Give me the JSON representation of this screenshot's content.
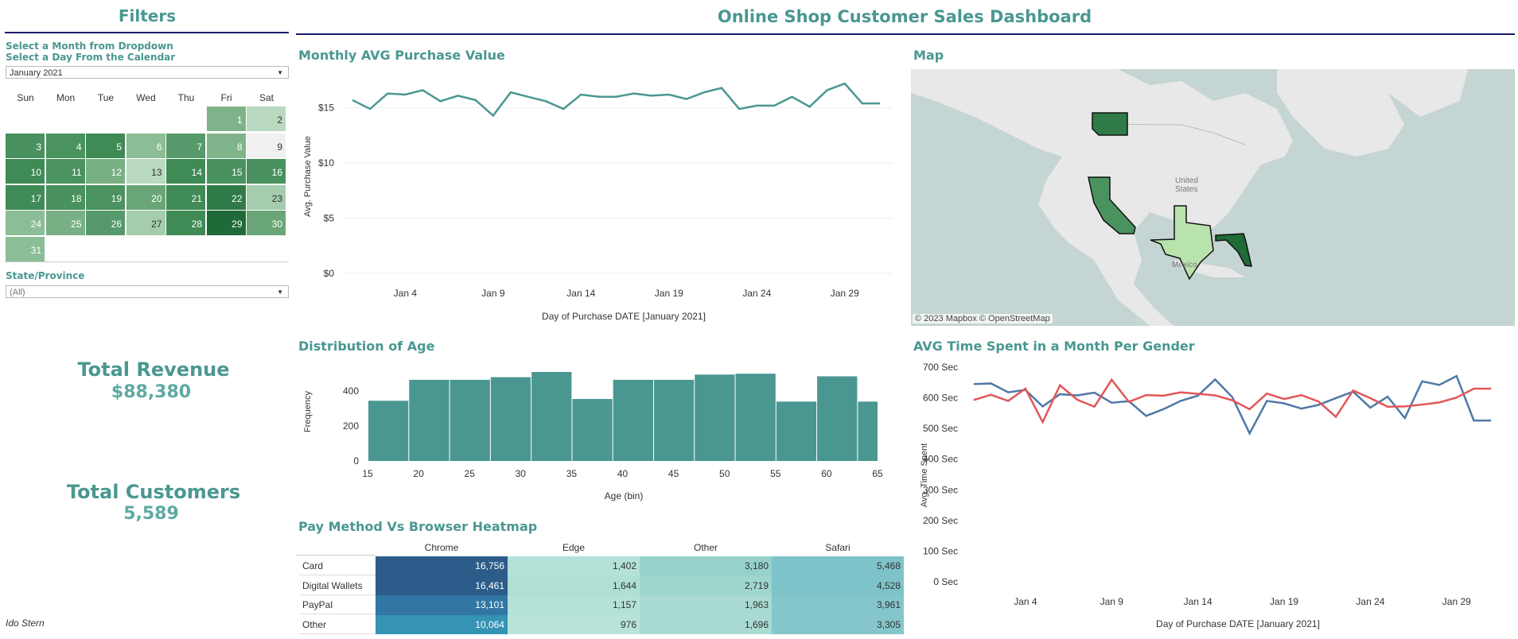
{
  "filters": {
    "title": "Filters",
    "month_instruction": "Select a Month from Dropdown",
    "day_instruction": "Select a Day From the Calendar",
    "month_value": "January 2021",
    "state_label": "State/Province",
    "state_value": "(All)"
  },
  "calendar": {
    "days": [
      "Sun",
      "Mon",
      "Tue",
      "Wed",
      "Thu",
      "Fri",
      "Sat"
    ],
    "start_weekday": 5,
    "num_days": 31,
    "cell_colors": [
      "#7fb48b",
      "#b9d9c1",
      "#49915e",
      "#4a935f",
      "#3f8a55",
      "#8bbd96",
      "#56996a",
      "#7fb48b",
      "#f0f0f0",
      "#3f8a55",
      "#4a935f",
      "#78b083",
      "#b9d9c1",
      "#3f8a55",
      "#49915e",
      "#49915e",
      "#3f8a55",
      "#49915e",
      "#4a935f",
      "#6aa577",
      "#3f8a55",
      "#2f7a46",
      "#a4ccad",
      "#8bbd96",
      "#78b083",
      "#56996a",
      "#a4ccad",
      "#3f8a55",
      "#1f6a37",
      "#6aa577",
      "#8bbd96"
    ]
  },
  "kpis": {
    "revenue_label": "Total Revenue",
    "revenue_value": "$88,380",
    "customers_label": "Total Customers",
    "customers_value": "5,589"
  },
  "author": "Ido Stern",
  "dashboard_title": "Online Shop Customer Sales Dashboard",
  "line_chart": {
    "title": "Monthly AVG Purchase Value",
    "chart_data": {
      "type": "line",
      "x": [
        1,
        2,
        3,
        4,
        5,
        6,
        7,
        8,
        9,
        10,
        11,
        12,
        13,
        14,
        15,
        16,
        17,
        18,
        19,
        20,
        21,
        22,
        23,
        24,
        25,
        26,
        27,
        28,
        29,
        30,
        31
      ],
      "values": [
        15.7,
        14.9,
        16.3,
        16.2,
        16.6,
        15.6,
        16.1,
        15.7,
        14.3,
        16.4,
        16.0,
        15.6,
        14.9,
        16.2,
        16.0,
        16.0,
        16.3,
        16.1,
        16.2,
        15.8,
        16.4,
        16.8,
        14.9,
        15.2,
        15.2,
        16.0,
        15.1,
        16.6,
        17.2,
        15.4,
        15.4
      ],
      "ylim": [
        0,
        18
      ],
      "yticks": [
        "$0",
        "$5",
        "$10",
        "$15"
      ],
      "ytick_values": [
        0,
        5,
        10,
        15
      ],
      "xticks": [
        "Jan 4",
        "Jan 9",
        "Jan 14",
        "Jan 19",
        "Jan 24",
        "Jan 29"
      ],
      "xtick_values": [
        4,
        9,
        14,
        19,
        24,
        29
      ],
      "xlabel": "Day of Purchase DATE [January 2021]",
      "ylabel": "Avg. Purchase Value",
      "color": "#4a9791"
    }
  },
  "map": {
    "title": "Map",
    "attribution": "© 2023 Mapbox  © OpenStreetMap",
    "labels": {
      "country": "United States",
      "mexico": "Mexico"
    },
    "state_colors": {
      "washington": "#2f7a46",
      "california": "#4a935f",
      "texas": "#b9e3ad",
      "florida": "#1f6a37"
    }
  },
  "histogram": {
    "title": "Distribution of Age",
    "chart_data": {
      "type": "bar",
      "bin_starts": [
        15,
        19,
        23,
        27,
        31,
        35,
        39,
        43,
        47,
        51,
        55,
        59,
        63
      ],
      "bin_width": 4,
      "values": [
        345,
        465,
        465,
        480,
        510,
        355,
        465,
        465,
        495,
        500,
        340,
        485,
        340
      ],
      "ylim": [
        0,
        560
      ],
      "yticks": [
        "0",
        "200",
        "400"
      ],
      "ytick_values": [
        0,
        200,
        400
      ],
      "xticks": [
        "15",
        "20",
        "25",
        "30",
        "35",
        "40",
        "45",
        "50",
        "55",
        "60",
        "65"
      ],
      "xtick_values": [
        15,
        20,
        25,
        30,
        35,
        40,
        45,
        50,
        55,
        60,
        65
      ],
      "xlim": [
        15,
        65
      ],
      "xlabel": "Age (bin)",
      "ylabel": "Frequency",
      "color": "#4a9791"
    }
  },
  "heatmap": {
    "title": "Pay Method Vs Browser Heatmap",
    "chart_data": {
      "type": "heatmap",
      "columns": [
        "Chrome",
        "Edge",
        "Other",
        "Safari"
      ],
      "rows": [
        "Card",
        "Digital Wallets",
        "PayPal",
        "Other"
      ],
      "values": [
        [
          16756,
          1402,
          3180,
          5468
        ],
        [
          16461,
          1644,
          2719,
          4528
        ],
        [
          13101,
          1157,
          1963,
          3961
        ],
        [
          10064,
          976,
          1696,
          3305
        ]
      ],
      "labels": [
        [
          "16,756",
          "1,402",
          "3,180",
          "5,468"
        ],
        [
          "16,461",
          "1,644",
          "2,719",
          "4,528"
        ],
        [
          "13,101",
          "1,157",
          "1,963",
          "3,961"
        ],
        [
          "10,064",
          "976",
          "1,696",
          "3,305"
        ]
      ],
      "colors": [
        [
          "#2c5d8a",
          "#b4e1d8",
          "#96d1cb",
          "#7ec3c9"
        ],
        [
          "#2c5d8a",
          "#afdfd5",
          "#9fd6cd",
          "#7ec3c9"
        ],
        [
          "#3277a3",
          "#b4e1d8",
          "#aadbd2",
          "#84c6cb"
        ],
        [
          "#3593b4",
          "#b8e3d9",
          "#aadbd2",
          "#84c6cb"
        ]
      ]
    }
  },
  "gender_chart": {
    "title": "AVG Time Spent in a Month Per Gender",
    "chart_data": {
      "type": "line",
      "x": [
        1,
        2,
        3,
        4,
        5,
        6,
        7,
        8,
        9,
        10,
        11,
        12,
        13,
        14,
        15,
        16,
        17,
        18,
        19,
        20,
        21,
        22,
        23,
        24,
        25,
        26,
        27,
        28,
        29,
        30,
        31
      ],
      "series": [
        {
          "color": "#4e79a7",
          "values": [
            645,
            647,
            618,
            626,
            572,
            612,
            608,
            617,
            584,
            589,
            541,
            563,
            590,
            607,
            660,
            602,
            484,
            590,
            582,
            565,
            577,
            599,
            620,
            568,
            604,
            534,
            654,
            642,
            671,
            526,
            526
          ]
        },
        {
          "color": "#e15759",
          "values": [
            593,
            610,
            590,
            630,
            521,
            641,
            594,
            571,
            659,
            587,
            609,
            607,
            618,
            613,
            608,
            592,
            563,
            614,
            596,
            609,
            588,
            538,
            624,
            599,
            571,
            572,
            578,
            585,
            601,
            630,
            630
          ]
        }
      ],
      "ylim": [
        0,
        700
      ],
      "yticks": [
        "0 Sec",
        "100 Sec",
        "200 Sec",
        "300 Sec",
        "400 Sec",
        "500 Sec",
        "600 Sec",
        "700 Sec"
      ],
      "ytick_values": [
        0,
        100,
        200,
        300,
        400,
        500,
        600,
        700
      ],
      "xticks": [
        "Jan 4",
        "Jan 9",
        "Jan 14",
        "Jan 19",
        "Jan 24",
        "Jan 29"
      ],
      "xtick_values": [
        4,
        9,
        14,
        19,
        24,
        29
      ],
      "xlabel": "Day of Purchase DATE [January 2021]",
      "ylabel": "Avg. Time Spent"
    }
  }
}
